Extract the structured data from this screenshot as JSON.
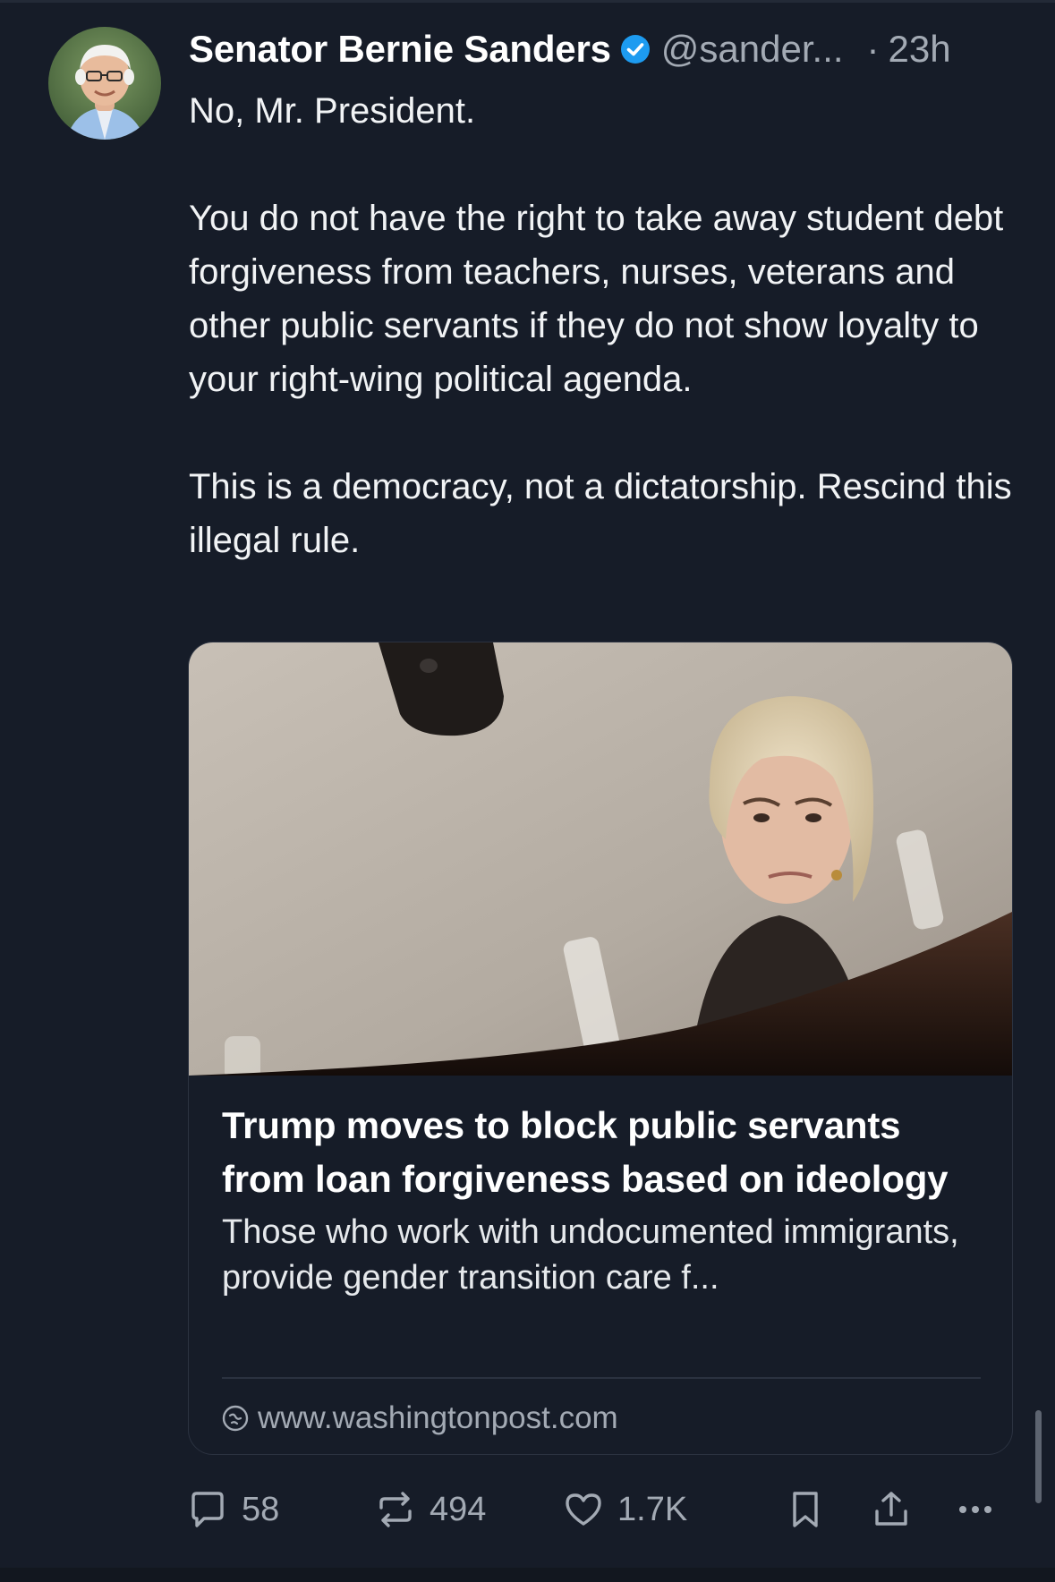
{
  "post": {
    "author_name": "Senator Bernie Sanders",
    "handle": "@sander...",
    "separator": "·",
    "timestamp": "23h",
    "text_paragraphs": [
      "No, Mr. President.",
      "You do not have the right to take away student debt forgiveness from teachers, nurses, veterans and other public servants if they do not show loyalty to your right-wing political agenda.",
      "This is a democracy, not a dictatorship. Rescind this illegal rule."
    ]
  },
  "link_card": {
    "title": "Trump moves to block public servants from loan forgiveness based on ideology",
    "description": "Those who work with undocumented immigrants, provide gender transition care f...",
    "source": "www.washingtonpost.com"
  },
  "actions": {
    "replies": "58",
    "reposts": "494",
    "likes": "1.7K"
  },
  "icons": {
    "verified": "verified-badge-icon",
    "reply": "speech-bubble-icon",
    "repost": "repost-arrows-icon",
    "like": "heart-icon",
    "bookmark": "bookmark-icon",
    "share": "share-upload-icon",
    "more": "ellipsis-icon",
    "source": "globe-link-icon"
  },
  "colors": {
    "background": "#161c28",
    "text": "#f1f3f5",
    "muted": "#a3aab4",
    "verified_blue": "#1d9bf0"
  }
}
